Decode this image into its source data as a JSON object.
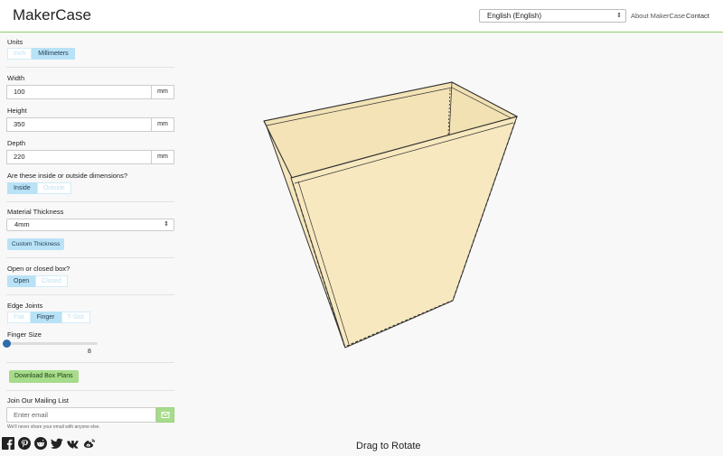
{
  "header": {
    "brand": "MakerCase",
    "language": "English (English)",
    "about": "About MakerCase",
    "contact": "Contact"
  },
  "sidebar": {
    "units_label": "Units",
    "units_options": [
      "Inch",
      "Millimeters"
    ],
    "units_selected": "Millimeters",
    "width_label": "Width",
    "width_value": "100",
    "height_label": "Height",
    "height_value": "350",
    "depth_label": "Depth",
    "depth_value": "220",
    "unit_suffix": "mm",
    "dimension_question": "Are these inside or outside dimensions?",
    "dimension_options": [
      "Inside",
      "Outside"
    ],
    "dimension_selected": "Inside",
    "thickness_label": "Material Thickness",
    "thickness_value": "4mm",
    "custom_thickness": "Custom Thickness",
    "box_question": "Open or closed box?",
    "box_options": [
      "Open",
      "Closed"
    ],
    "box_selected": "Open",
    "edge_label": "Edge Joints",
    "edge_options": [
      "Flat",
      "Finger",
      "T-Slot"
    ],
    "edge_selected": "Finger",
    "finger_label": "Finger Size",
    "finger_value": "8",
    "download": "Download Box Plans",
    "mailing_label": "Join Our Mailing List",
    "email_placeholder": "Enter email",
    "email_help": "We'll never share your email with anyone else."
  },
  "social_icons": [
    "facebook-icon",
    "pinterest-icon",
    "reddit-icon",
    "twitter-icon",
    "vk-icon",
    "weibo-icon"
  ],
  "viewer": {
    "drag_hint": "Drag to Rotate"
  },
  "colors": {
    "accent_green": "#8fcf6a",
    "toggle_blue": "#b9e2f7",
    "box_fill": "#f7e8bf",
    "slider_blue": "#2c6da8"
  }
}
